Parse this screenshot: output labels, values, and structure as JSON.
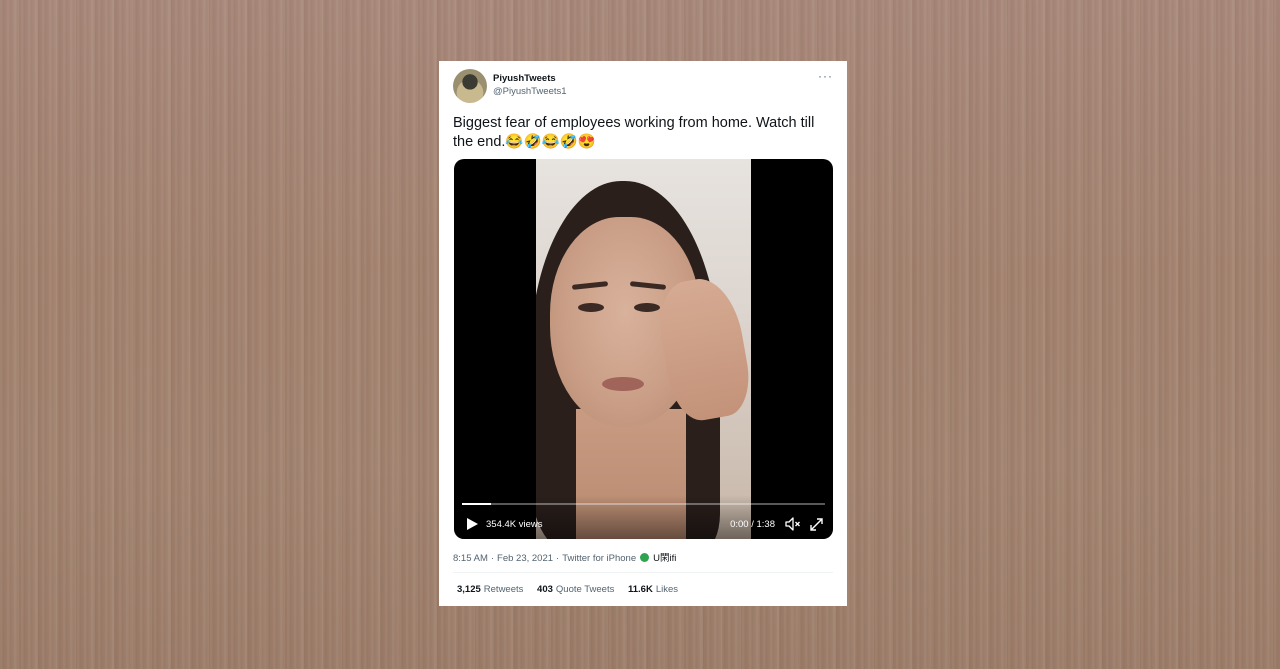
{
  "tweet": {
    "display_name": "PiyushTweets",
    "handle": "@PiyushTweets1",
    "more_label": "···",
    "text": "Biggest fear of employees working from home. Watch till the end.😂🤣😂🤣😍"
  },
  "video": {
    "views": "354.4K views",
    "time": "0:00 / 1:38",
    "progress": 0.08,
    "play_icon": "play-icon",
    "volume_icon": "volume-icon",
    "expand_icon": "expand-icon"
  },
  "meta": {
    "time": "8:15 AM",
    "date": "Feb 23, 2021",
    "source": "Twitter for iPhone",
    "location_icon": "globe-icon",
    "location": "U閑ifi"
  },
  "stats": {
    "retweets_count": "3,125",
    "retweets_label": "Retweets",
    "quotes_count": "403",
    "quotes_label": "Quote Tweets",
    "likes_count": "11.6K",
    "likes_label": "Likes"
  },
  "colors": {
    "background": "#a3826f",
    "card": "#ffffff",
    "text_primary": "#0f1419",
    "text_secondary": "#536471"
  }
}
